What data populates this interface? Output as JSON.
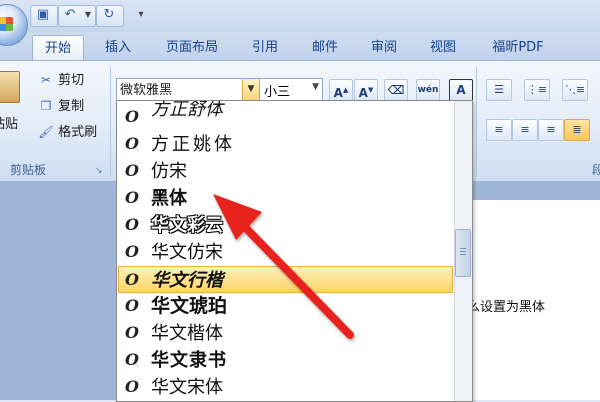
{
  "toolbar": {
    "tabs": [
      "开始",
      "插入",
      "页面布局",
      "引用",
      "邮件",
      "审阅",
      "视图",
      "福昕PDF"
    ],
    "qat_icons": [
      "save-icon",
      "undo-icon",
      "redo-icon",
      "customize-icon"
    ]
  },
  "clipboard": {
    "paste_label": "粘贴",
    "cut_label": "剪切",
    "copy_label": "复制",
    "format_painter_label": "格式刷",
    "group_title": "剪贴板"
  },
  "font": {
    "current_font": "微软雅黑",
    "current_size": "小三",
    "font_list": [
      "方正舒体",
      "方正姚体",
      "仿宋",
      "黑体",
      "华文彩云",
      "华文仿宋",
      "华文行楷",
      "华文琥珀",
      "华文楷体",
      "华文隶书",
      "华文宋体"
    ],
    "highlighted_font": "华文行楷"
  },
  "document": {
    "visible_text": "体怎么设置为黑体"
  },
  "colors": {
    "highlight": "#fcd467",
    "arrow": "#e8241e",
    "ribbon_text": "#15428b"
  }
}
